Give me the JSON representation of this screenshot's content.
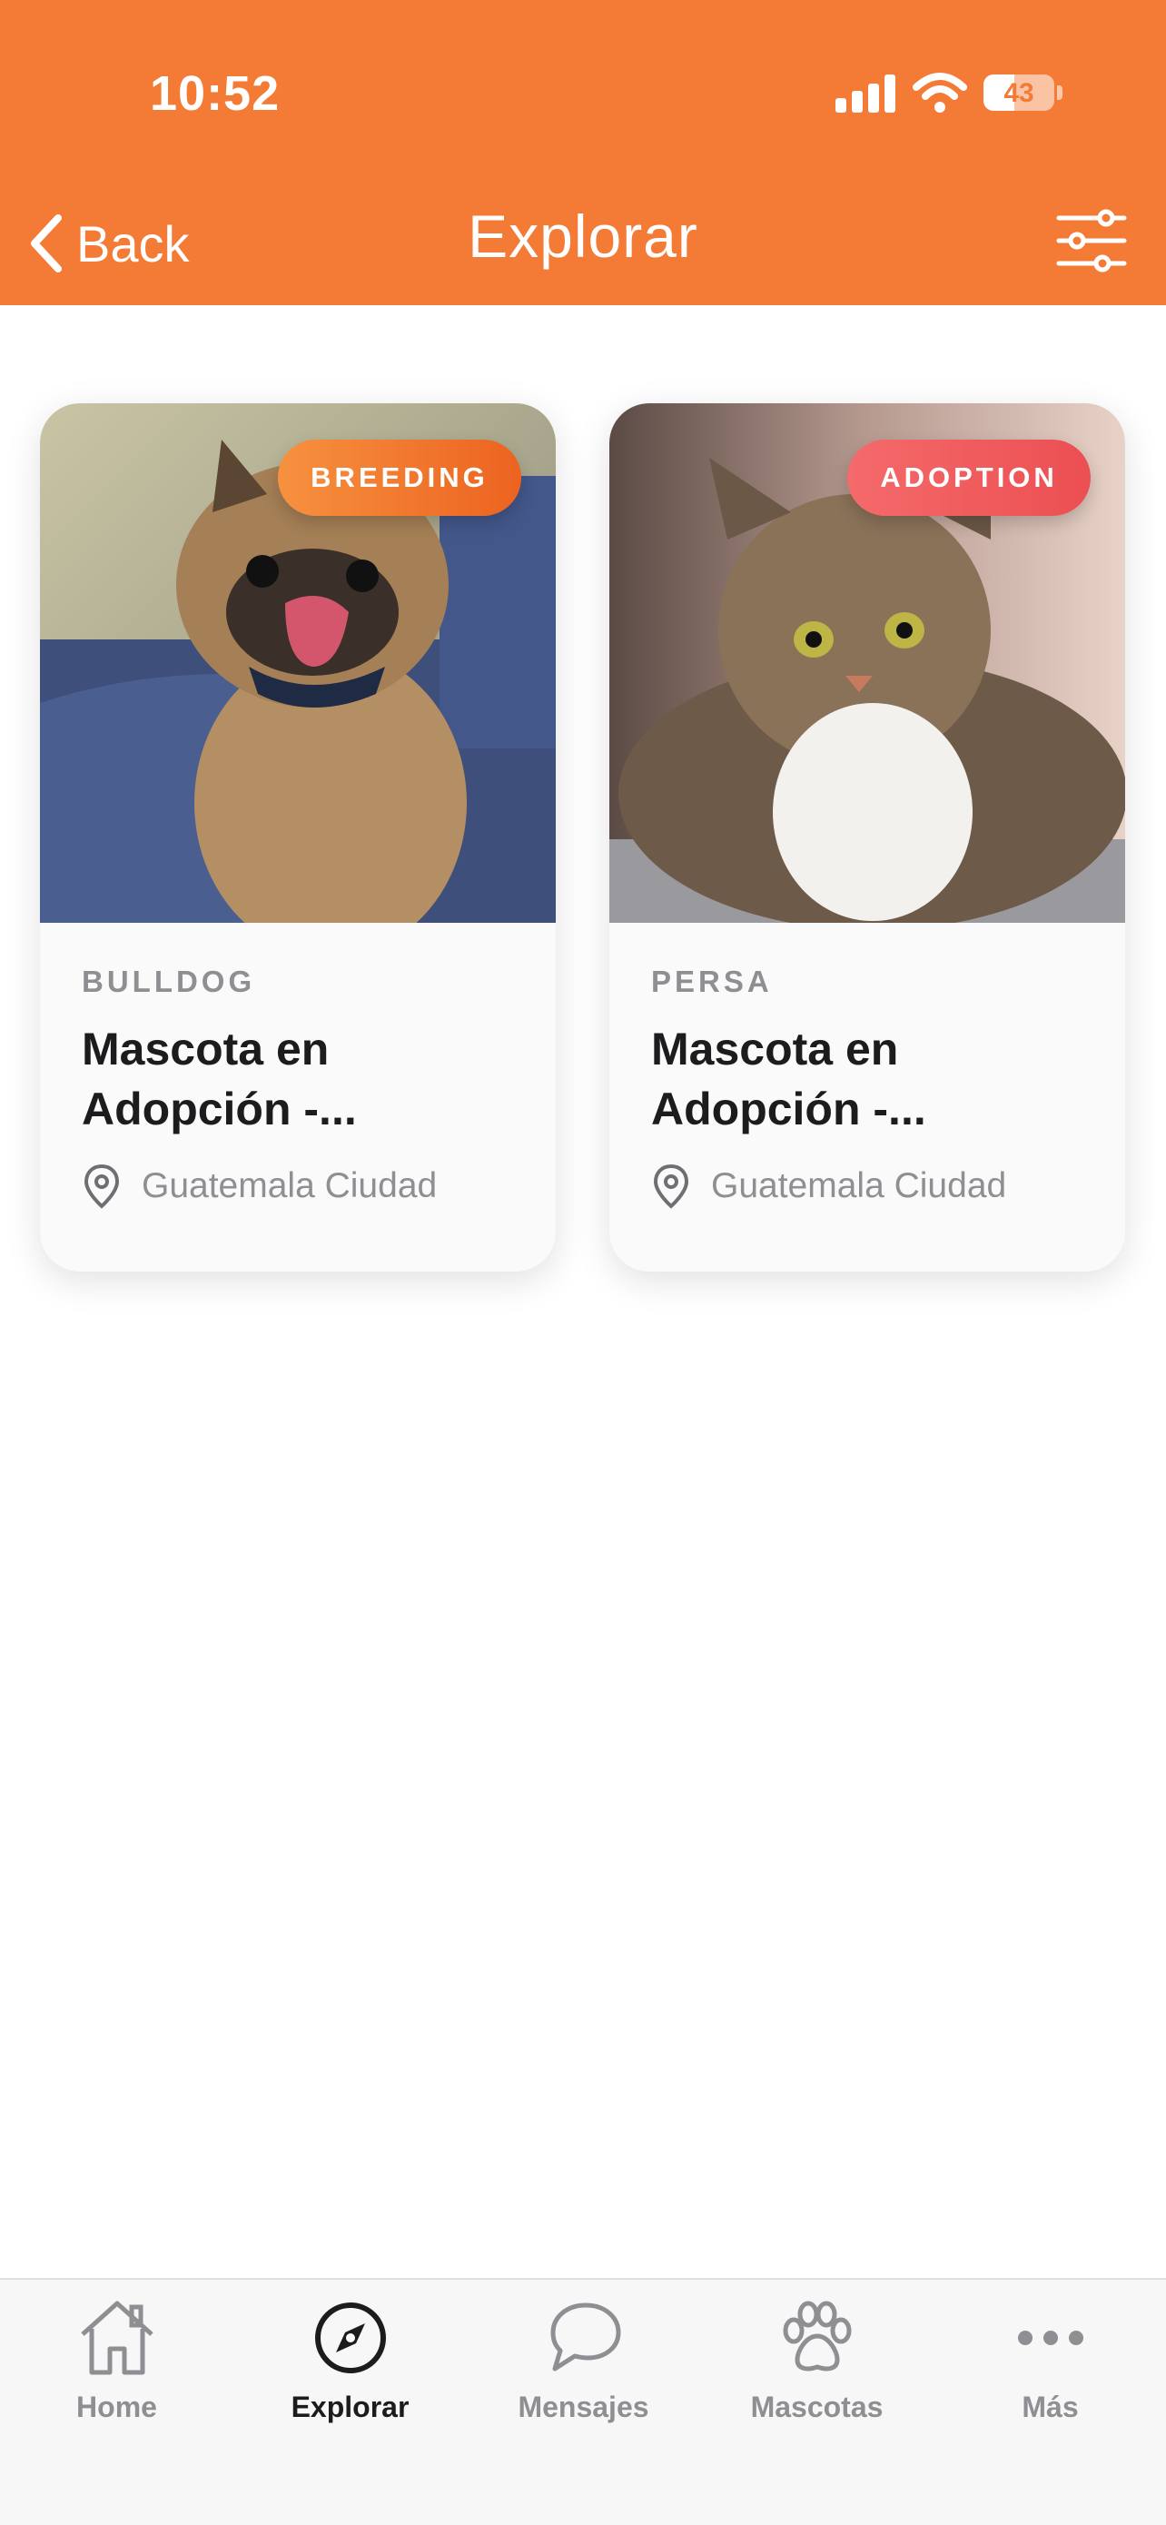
{
  "status_bar": {
    "time": "10:52",
    "battery": "43"
  },
  "nav": {
    "back_label": "Back",
    "title": "Explorar"
  },
  "pets": [
    {
      "badge": "BREEDING",
      "breed": "BULLDOG",
      "title": "Mascota en Adopción -...",
      "location": "Guatemala Ciudad"
    },
    {
      "badge": "ADOPTION",
      "breed": "PERSA",
      "title": "Mascota en Adopción -...",
      "location": "Guatemala Ciudad"
    }
  ],
  "tabs": [
    {
      "label": "Home",
      "icon": "home-icon"
    },
    {
      "label": "Explorar",
      "icon": "compass-icon",
      "active": true
    },
    {
      "label": "Mensajes",
      "icon": "chat-icon"
    },
    {
      "label": "Mascotas",
      "icon": "paw-icon"
    },
    {
      "label": "Más",
      "icon": "more-icon"
    }
  ],
  "colors": {
    "accent": "#F47B36",
    "breeding": "#EF6B25",
    "adoption": "#EF5456"
  }
}
